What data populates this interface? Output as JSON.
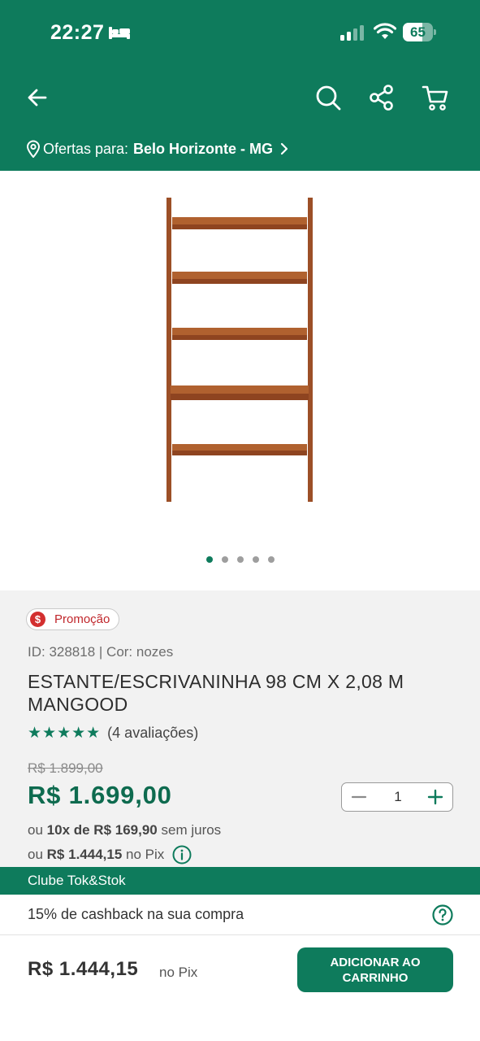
{
  "status_bar": {
    "time": "22:27",
    "battery_percent": 65,
    "battery_label": "65"
  },
  "nav": {
    "icons": [
      "arrow-left-icon",
      "search-icon",
      "share-icon",
      "cart-icon"
    ]
  },
  "location": {
    "prefix": "Ofertas para:",
    "city": "Belo Horizonte - MG"
  },
  "gallery": {
    "image_count": 5,
    "active_index": 0
  },
  "product": {
    "badge": "Promoção",
    "badge_symbol": "$",
    "id_line": "ID: 328818 | Cor: nozes",
    "title": "ESTANTE/ESCRIVANINHA 98 CM X 2,08 M MANGOOD",
    "stars": "★★★★★",
    "rating_count": "(4 avaliações)",
    "old_price": "R$ 1.899,00",
    "price": "R$ 1.699,00",
    "quantity": "1",
    "installments_prefix": "ou",
    "installments_value": "10x de R$ 169,90",
    "installments_suffix": "sem juros",
    "pix_prefix": "ou",
    "pix_value": "R$ 1.444,15",
    "pix_suffix": "no Pix"
  },
  "club": {
    "title": "Clube Tok&Stok",
    "cashback": "15% de cashback na sua compra"
  },
  "footer": {
    "price": "R$ 1.444,15",
    "price_suffix": "no Pix",
    "add_button": "ADICIONAR AO CARRINHO"
  },
  "colors": {
    "brand_green": "#0e7b5c",
    "price_green": "#0e6b4f",
    "promo_red": "#d32f2f",
    "wood": "#a0522d"
  }
}
